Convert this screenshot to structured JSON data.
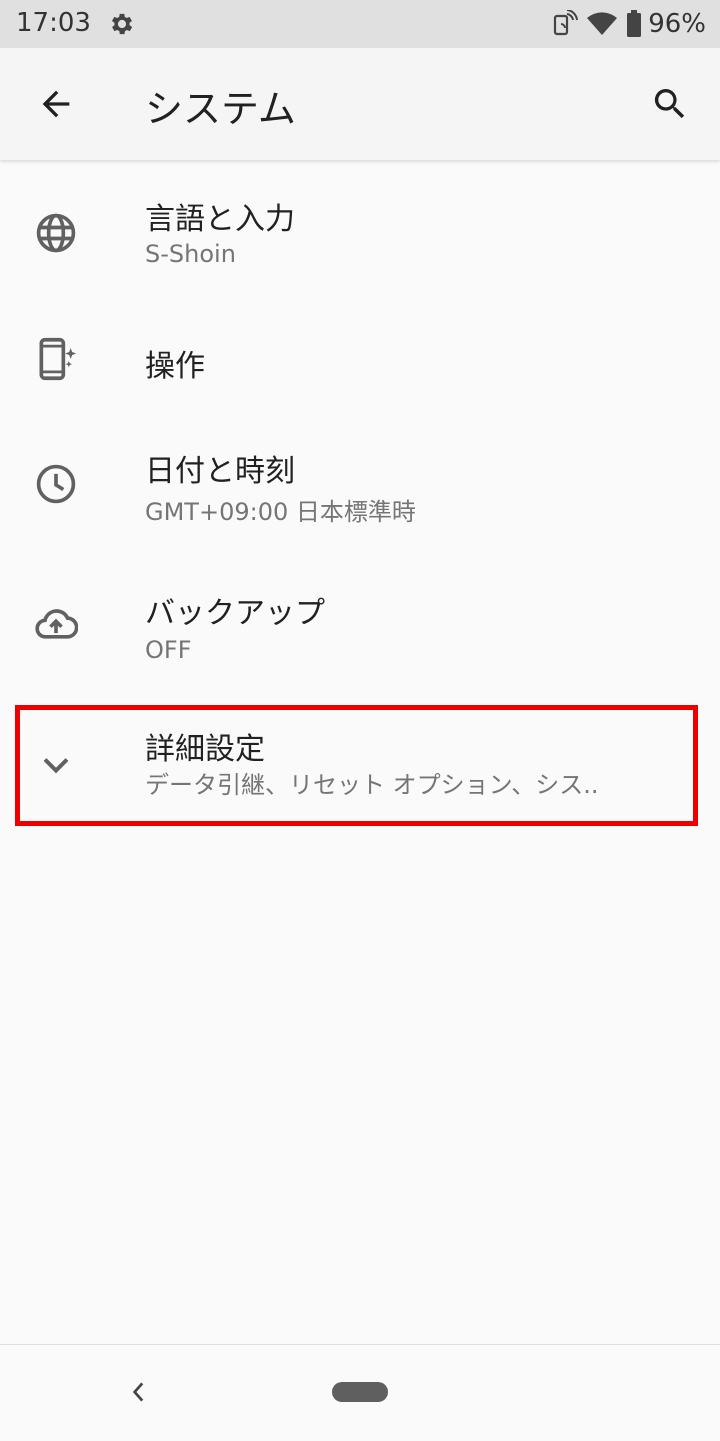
{
  "status_bar": {
    "time": "17:03",
    "battery_percent": "96%"
  },
  "app_bar": {
    "title": "システム"
  },
  "items": [
    {
      "label": "言語と入力",
      "sublabel": "S-Shoin",
      "icon": "globe-icon"
    },
    {
      "label": "操作",
      "sublabel": "",
      "icon": "phone-gesture-icon"
    },
    {
      "label": "日付と時刻",
      "sublabel": "GMT+09:00 日本標準時",
      "icon": "clock-icon"
    },
    {
      "label": "バックアップ",
      "sublabel": "OFF",
      "icon": "cloud-upload-icon"
    },
    {
      "label": "詳細設定",
      "sublabel": "データ引継、リセット オプション、シス..",
      "icon": "chevron-down-icon"
    }
  ],
  "colors": {
    "highlight": "#ee0000",
    "icon": "#616161"
  }
}
